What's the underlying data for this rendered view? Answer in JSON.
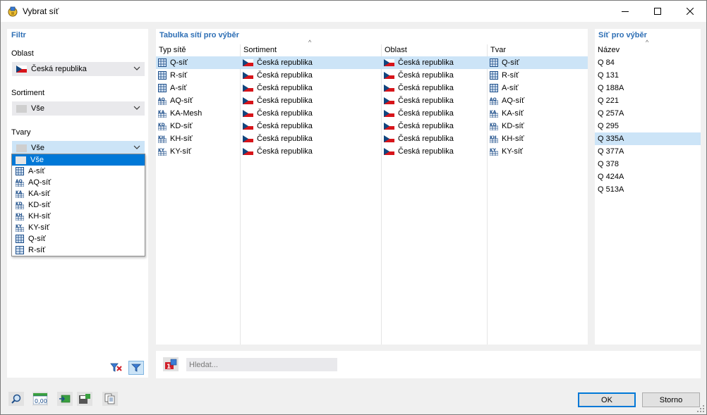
{
  "window": {
    "title": "Vybrat síť"
  },
  "filter": {
    "title": "Filtr",
    "region_label": "Oblast",
    "region_value": "Česká republika",
    "assortment_label": "Sortiment",
    "assortment_value": "Vše",
    "shapes_label": "Tvary",
    "shapes_value": "Vše",
    "shape_options": [
      {
        "label": "Vše",
        "icon": "none",
        "selected": true
      },
      {
        "label": "A-síť",
        "icon": "mesh-a-icon"
      },
      {
        "label": "AQ-síť",
        "icon": "mesh-aq-icon"
      },
      {
        "label": "KA-síť",
        "icon": "mesh-ka-icon"
      },
      {
        "label": "KD-síť",
        "icon": "mesh-kd-icon"
      },
      {
        "label": "KH-síť",
        "icon": "mesh-kh-icon"
      },
      {
        "label": "KY-síť",
        "icon": "mesh-ky-icon"
      },
      {
        "label": "Q-síť",
        "icon": "mesh-q-icon"
      },
      {
        "label": "R-síť",
        "icon": "mesh-r-icon"
      }
    ]
  },
  "table": {
    "title": "Tabulka sítí pro výběr",
    "columns": [
      "Typ sítě",
      "Sortiment",
      "Oblast",
      "Tvar"
    ],
    "rows": [
      {
        "type": "Q-síť",
        "assortment": "Česká republika",
        "region": "Česká republika",
        "shape": "Q-síť",
        "selected": true
      },
      {
        "type": "R-síť",
        "assortment": "Česká republika",
        "region": "Česká republika",
        "shape": "R-síť"
      },
      {
        "type": "A-síť",
        "assortment": "Česká republika",
        "region": "Česká republika",
        "shape": "A-síť"
      },
      {
        "type": "AQ-síť",
        "assortment": "Česká republika",
        "region": "Česká republika",
        "shape": "AQ-síť"
      },
      {
        "type": "KA-Mesh",
        "assortment": "Česká republika",
        "region": "Česká republika",
        "shape": "KA-síť"
      },
      {
        "type": "KD-síť",
        "assortment": "Česká republika",
        "region": "Česká republika",
        "shape": "KD-síť"
      },
      {
        "type": "KH-síť",
        "assortment": "Česká republika",
        "region": "Česká republika",
        "shape": "KH-síť"
      },
      {
        "type": "KY-síť",
        "assortment": "Česká republika",
        "region": "Česká republika",
        "shape": "KY-síť"
      }
    ]
  },
  "nets": {
    "title": "Síť pro výběr",
    "column": "Název",
    "items": [
      "Q 84",
      "Q 131",
      "Q 188A",
      "Q 221",
      "Q 257A",
      "Q 295",
      "Q 335A",
      "Q 377A",
      "Q 378",
      "Q 424A",
      "Q 513A"
    ],
    "selected_index": 6
  },
  "search": {
    "placeholder": "Hledat..."
  },
  "buttons": {
    "ok": "OK",
    "cancel": "Storno"
  },
  "bottom_value_icon_text": "0,00",
  "colors": {
    "accent": "#2e6fb5",
    "selection": "#cce4f7",
    "dropdown_selection": "#0078d7"
  }
}
